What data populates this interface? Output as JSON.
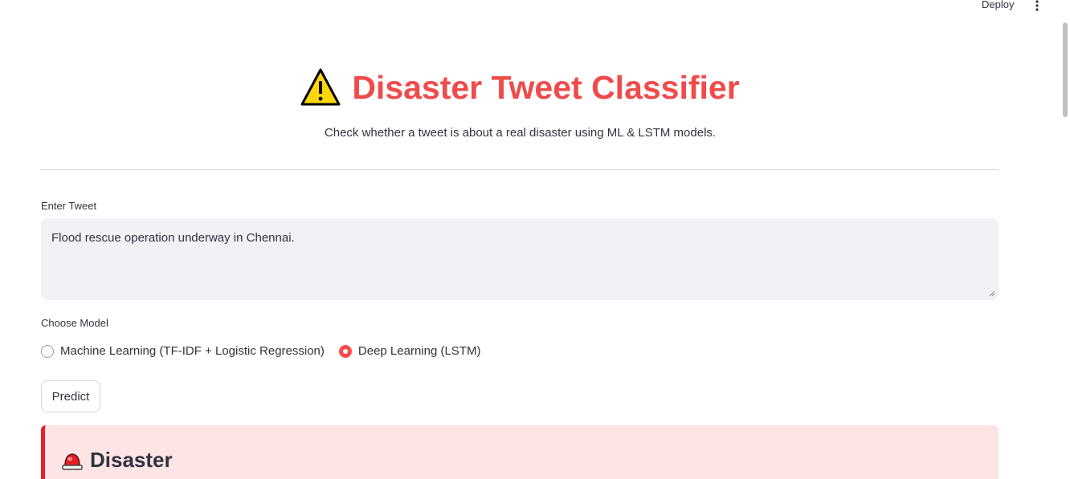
{
  "toolbar": {
    "deploy_label": "Deploy",
    "menu_icon": "more-vertical-icon"
  },
  "header": {
    "icon": "warning-icon",
    "title": "Disaster Tweet Classifier",
    "subtitle": "Check whether a tweet is about a real disaster using ML & LSTM models."
  },
  "tweet_input": {
    "label": "Enter Tweet",
    "value": "Flood rescue operation underway in Chennai."
  },
  "model_choice": {
    "label": "Choose Model",
    "options": [
      {
        "label": "Machine Learning (TF-IDF + Logistic Regression)",
        "selected": false
      },
      {
        "label": "Deep Learning (LSTM)",
        "selected": true
      }
    ]
  },
  "predict_button": {
    "label": "Predict"
  },
  "result": {
    "icon": "siren-icon",
    "label": "Disaster"
  },
  "colors": {
    "title": "#f04b4b",
    "accent": "#ff4b4b",
    "result_bg": "#fde4e5",
    "result_border": "#e8202a"
  }
}
